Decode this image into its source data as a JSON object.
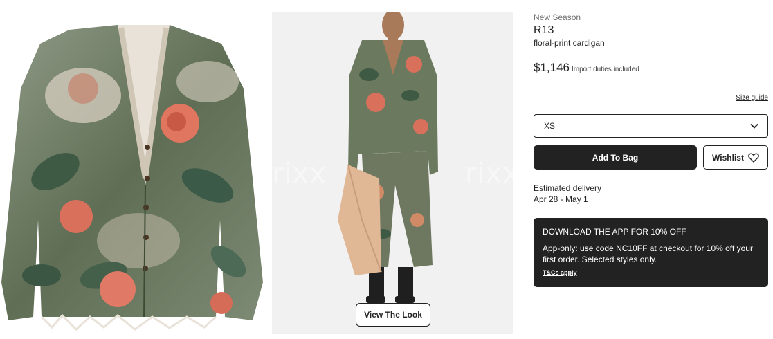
{
  "product": {
    "season": "New Season",
    "brand": "R13",
    "name": "floral-print cardigan",
    "price": "$1,146",
    "duties_note": "Import duties included"
  },
  "gallery": {
    "watermark_text": "rixx",
    "view_look_label": "View The Look"
  },
  "size_guide_label": "Size guide",
  "size_select": {
    "selected": "XS"
  },
  "actions": {
    "add_to_bag": "Add To Bag",
    "wishlist": "Wishlist"
  },
  "delivery": {
    "label": "Estimated delivery",
    "range": "Apr 28 - May 1"
  },
  "promo": {
    "title": "DOWNLOAD THE APP FOR 10% OFF",
    "body": "App-only: use code NC10FF at checkout for 10% off your first order. Selected styles only.",
    "terms": "T&Cs apply"
  },
  "colors": {
    "dark": "#222222",
    "muted_text": "#727272",
    "photo_bg": "#f1f1f1"
  },
  "icons": {
    "select_arrow": "chevron-down-icon",
    "wishlist": "heart-icon"
  }
}
